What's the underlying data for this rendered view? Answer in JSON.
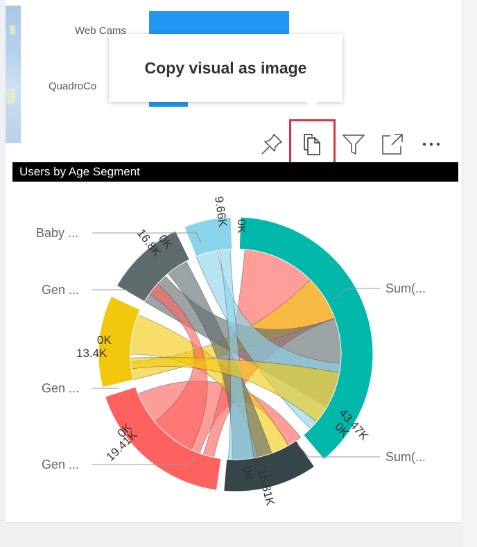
{
  "previous_visual": {
    "category_labels": [
      "Web Cams",
      "QuadroCo"
    ],
    "bar_color": "#2196f3"
  },
  "tooltip": {
    "text": "Copy visual as image"
  },
  "toolbar": {
    "icons": [
      "pin-icon",
      "copy-icon",
      "filter-icon",
      "focus-mode-icon",
      "more-options-icon"
    ],
    "more_label": "···",
    "highlight_color": "#e0323c"
  },
  "visual": {
    "title": "Users by Age Segment"
  },
  "chart_data": {
    "type": "chord",
    "title": "Users by Age Segment",
    "groups": [
      {
        "label": "Sum(...",
        "color": "#01b8aa",
        "ticks": [
          "0K",
          "43.47K"
        ]
      },
      {
        "label": "Sum(...",
        "color": "#374649",
        "ticks": [
          "0K",
          "15.81K"
        ]
      },
      {
        "label": "Gen ...",
        "color": "#fd625e",
        "ticks": [
          "0K",
          "19.41K"
        ]
      },
      {
        "label": "Gen ...",
        "color": "#f2c80f",
        "ticks": [
          "0K",
          "13.4K"
        ]
      },
      {
        "label": "Gen ...",
        "color": "#5f6b6d",
        "ticks": [
          "0K",
          "16.8K"
        ]
      },
      {
        "label": "Baby ...",
        "color": "#8ad4eb",
        "ticks": [
          "0K",
          "9.66K"
        ]
      }
    ]
  }
}
